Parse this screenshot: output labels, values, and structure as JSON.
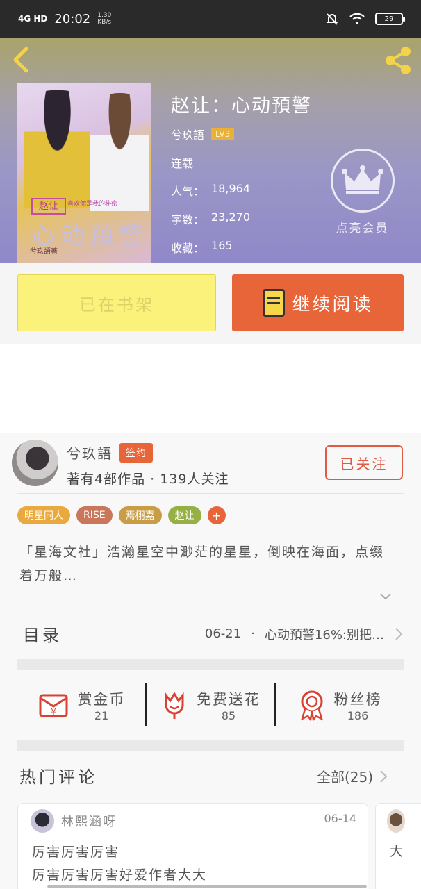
{
  "status_bar": {
    "network": "4G HD",
    "time": "20:02",
    "speed_value": "1.30",
    "speed_unit": "KB/s",
    "battery": "29"
  },
  "book": {
    "title": "赵让：心动預警",
    "author": "兮玖語",
    "level_badge": "LV3",
    "status": "连载",
    "popularity_label": "人气：",
    "popularity": "18,964",
    "wordcount_label": "字数：",
    "wordcount": "23,270",
    "favorites_label": "收藏：",
    "favorites": "165",
    "cover_text": {
      "small_title": "赵让",
      "subtitle": "喜欢你是我的秘密",
      "big_title": "心动預警",
      "by_line": "兮玖語著"
    }
  },
  "vip": {
    "label": "点亮会员"
  },
  "actions": {
    "shelf_label": "已在书架",
    "read_label": "继续阅读"
  },
  "author_card": {
    "name": "兮玖語",
    "sign_badge": "签约",
    "stats": "著有4部作品 · 139人关注",
    "follow_label": "已关注",
    "tags": [
      {
        "label": "明星同人",
        "color": "#e9a93c"
      },
      {
        "label": "RISE",
        "color": "#c9765a"
      },
      {
        "label": "焉栩嘉",
        "color": "#c99d45"
      },
      {
        "label": "赵让",
        "color": "#97b045"
      }
    ],
    "tag_more": "+",
    "intro": "「星海文社」浩瀚星空中渺茫的星星，倒映在海面，点缀着万般…"
  },
  "toc": {
    "label": "目录",
    "latest_date": "06-21",
    "latest_dot": "·",
    "latest_chapter": "心动預警16%:别把…"
  },
  "rewards": [
    {
      "label": "赏金币",
      "value": "21",
      "icon": "red-envelope-icon"
    },
    {
      "label": "免费送花",
      "value": "85",
      "icon": "flower-icon"
    },
    {
      "label": "粉丝榜",
      "value": "186",
      "icon": "medal-icon"
    }
  ],
  "comments": {
    "title": "热门评论",
    "all_label": "全部(25)",
    "items": [
      {
        "user": "林熙涵呀",
        "date": "06-14",
        "line1": "厉害厉害厉害",
        "line2": "厉害厉害厉害好爱作者大大"
      },
      {
        "line1": "大"
      }
    ]
  },
  "colors": {
    "accent": "#e8653a",
    "shelf_button": "#fbf27c",
    "back_icon": "#f3d34a"
  }
}
